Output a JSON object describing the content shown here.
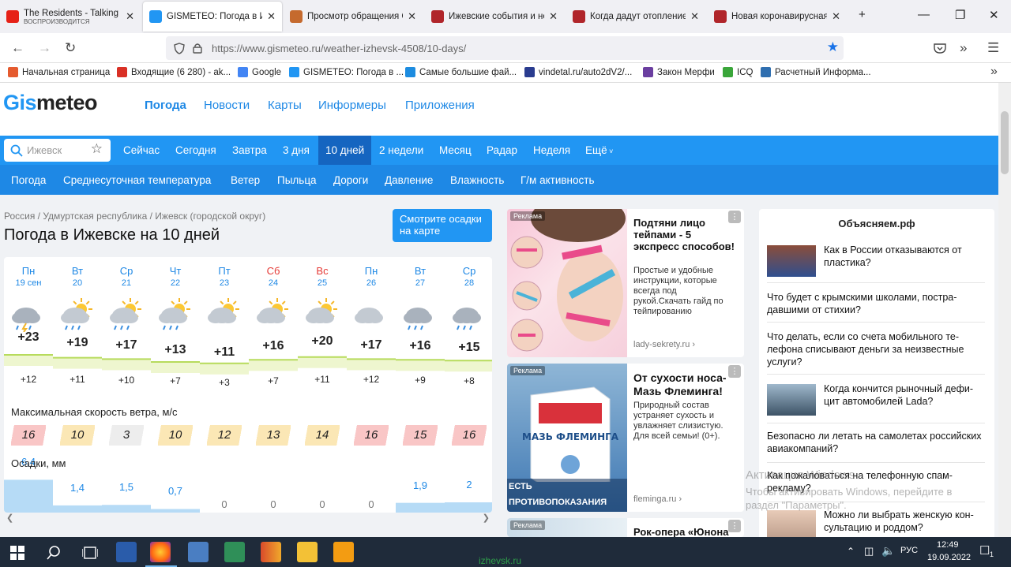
{
  "browser": {
    "tabs": [
      {
        "title": "The Residents - Talking L",
        "subtitle": "ВОСПРОИЗВОДИТСЯ",
        "icon": "youtube-icon",
        "color": "#e62117"
      },
      {
        "title": "GISMETEO: Погода в Иж",
        "icon": "gismeteo-icon",
        "color": "#2196f3",
        "active": true
      },
      {
        "title": "Просмотр обращения С",
        "icon": "arc-icon",
        "color": "#c56a2e"
      },
      {
        "title": "Ижевские события и но",
        "icon": "izhlife-icon",
        "color": "#b0252a"
      },
      {
        "title": "Когда дадут отопление",
        "icon": "izhlife-icon",
        "color": "#b0252a"
      },
      {
        "title": "Новая коронавирусная",
        "icon": "izhlife-icon",
        "color": "#b0252a"
      }
    ],
    "new_tab": "+",
    "url_host": "https://www.gismeteo.ru",
    "url_path": "/weather-izhevsk-4508/10-days/",
    "bookmarks": [
      {
        "label": "Начальная страница",
        "color": "#e55b2f"
      },
      {
        "label": "Входящие (6 280) - ak...",
        "color": "#d93025"
      },
      {
        "label": "Google",
        "color": "#4285f4"
      },
      {
        "label": "GISMETEO: Погода в ...",
        "color": "#2196f3"
      },
      {
        "label": "Самые большие фай...",
        "color": "#1d8ce0"
      },
      {
        "label": "vindetal.ru/auto2dV2/...",
        "color": "#2a3c8f"
      },
      {
        "label": "Закон Мерфи",
        "color": "#6b3fa0"
      },
      {
        "label": "ICQ",
        "color": "#3aa63a"
      },
      {
        "label": "Расчетный Информа...",
        "color": "#2f6fb0"
      }
    ]
  },
  "site": {
    "logo_a": "Gis",
    "logo_b": "meteo",
    "topnav": [
      "Погода",
      "Новости",
      "Карты",
      "Информеры",
      "Приложения"
    ],
    "search_placeholder": "Ижевск",
    "periods": [
      "Сейчас",
      "Сегодня",
      "Завтра",
      "3 дня",
      "10 дней",
      "2 недели",
      "Месяц",
      "Радар",
      "Неделя",
      "Ещё"
    ],
    "subnav": [
      "Погода",
      "Среднесуточная температура",
      "Ветер",
      "Пыльца",
      "Дороги",
      "Давление",
      "Влажность",
      "Г/м активность"
    ],
    "breadcrumb": "Россия / Удмуртская республика / Ижевск (городской округ)",
    "title": "Погода в Ижевске на 10 дней",
    "radar_button": "Смотрите осадки на карте",
    "wind_label": "Максимальная скорость ветра, м/с",
    "precip_label": "Осадки, мм",
    "days": [
      {
        "name": "Пн",
        "date": "19 сен",
        "icon": "thunderstorm-icon",
        "max": "+23",
        "min": "+12",
        "wind": "16",
        "precip": "6,4",
        "p": 6.4,
        "weekend": false
      },
      {
        "name": "Вт",
        "date": "20",
        "icon": "sun-cloud-rain-icon",
        "max": "+19",
        "min": "+11",
        "wind": "10",
        "precip": "1,4",
        "p": 1.4,
        "weekend": false
      },
      {
        "name": "Ср",
        "date": "21",
        "icon": "sun-cloud-rain-icon",
        "max": "+17",
        "min": "+10",
        "wind": "3",
        "precip": "1,5",
        "p": 1.5,
        "weekend": false
      },
      {
        "name": "Чт",
        "date": "22",
        "icon": "sun-cloud-rain-icon",
        "max": "+13",
        "min": "+7",
        "wind": "10",
        "precip": "0,7",
        "p": 0.7,
        "weekend": false
      },
      {
        "name": "Пт",
        "date": "23",
        "icon": "sun-cloud-icon",
        "max": "+11",
        "min": "+3",
        "wind": "12",
        "precip": "0",
        "p": 0,
        "weekend": false
      },
      {
        "name": "Сб",
        "date": "24",
        "icon": "sun-cloud-icon",
        "max": "+16",
        "min": "+7",
        "wind": "13",
        "precip": "0",
        "p": 0,
        "weekend": true
      },
      {
        "name": "Вс",
        "date": "25",
        "icon": "sun-cloud-icon",
        "max": "+20",
        "min": "+11",
        "wind": "14",
        "precip": "0",
        "p": 0,
        "weekend": true
      },
      {
        "name": "Пн",
        "date": "26",
        "icon": "cloud-icon",
        "max": "+17",
        "min": "+12",
        "wind": "16",
        "precip": "0",
        "p": 0,
        "weekend": false
      },
      {
        "name": "Вт",
        "date": "27",
        "icon": "cloud-rain-icon",
        "max": "+16",
        "min": "+9",
        "wind": "15",
        "precip": "1,9",
        "p": 1.9,
        "weekend": false
      },
      {
        "name": "Ср",
        "date": "28",
        "icon": "cloud-rain-icon",
        "max": "+15",
        "min": "+8",
        "wind": "16",
        "precip": "2",
        "p": 2,
        "weekend": false
      }
    ],
    "ads": [
      {
        "tag": "Реклама",
        "title": "Подтяни лицо тейпами - 5 экспресс способов!",
        "text": "Простые и удобные инструкции, которые всегда под рукой.Скачать гайд по тейпированию",
        "source": "lady-sekrety.ru"
      },
      {
        "tag": "Реклама",
        "title": "От сухости носа- Мазь Флеминга!",
        "text": "Природный состав устраняет сухость и увлажняет слизистую. Для всей семьи! (0+).",
        "source": "fleminga.ru",
        "img_caption": "ЕСТЬ ПРОТИВОПОКАЗАНИЯ ПОСОВЕТУЙТЕСЬ С ВРАЧОМ",
        "product": "МАЗЬ ФЛЕМИНГА"
      },
      {
        "tag": "Реклама",
        "title": "Рок-опера «Юнона"
      }
    ],
    "explain": {
      "title": "Объясняем.рф",
      "items": [
        "Как в России отказываются от пластика?",
        "Что будет с крымскими школами, постра­давшими от стихии?",
        "Что делать, если со счета мобильного те­лефона списывают деньги за неизвестные услуги?",
        "Когда кончится рыночный дефи­цит автомобилей Lada?",
        "Безопасно ли летать на самолетах россий­ских авиакомпаний?",
        "Как пожаловаться на телефонную спам-рекламу?",
        "Можно ли выбрать женскую кон­сультацию и роддом?"
      ]
    },
    "watermark_1": "Активация Windows",
    "watermark_2": "Чтобы активировать Windows, перейдите в раздел \"Параметры\"."
  },
  "taskbar": {
    "lang": "РУС",
    "time": "12:49",
    "date": "19.09.2022",
    "notifications": "1",
    "status_url": "izhevsk.ru"
  }
}
